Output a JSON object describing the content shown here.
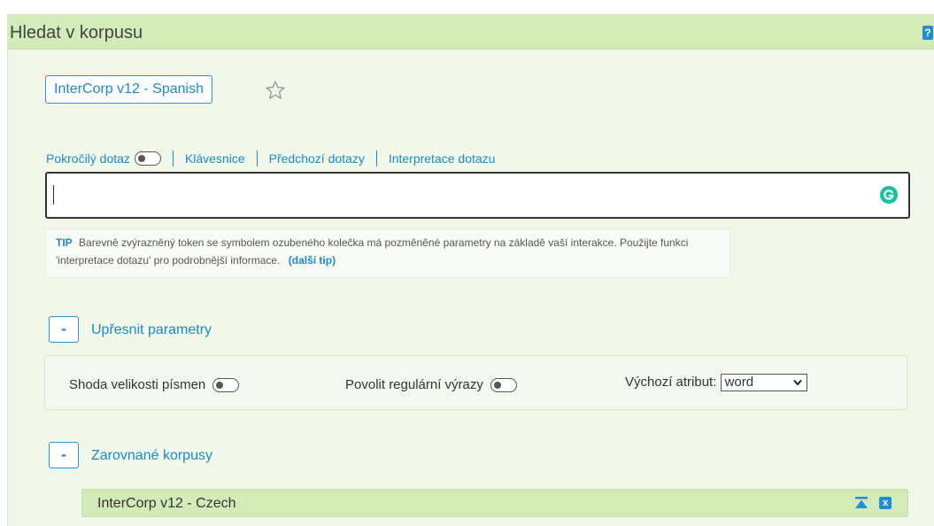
{
  "header": {
    "title": "Hledat v korpusu",
    "help_label": "?"
  },
  "corpus": {
    "name": "InterCorp v12 - Spanish"
  },
  "query_links": {
    "advanced": "Pokročilý dotaz",
    "keyboard": "Klávesnice",
    "history": "Předchozí dotazy",
    "interpretation": "Interpretace dotazu"
  },
  "query_input": {
    "value": ""
  },
  "tip": {
    "label": "TIP",
    "text": "Barevně zvýrazněný token se symbolem ozubeného kolečka má pozměněné parametry na základě vaší interakce. Použijte funkci 'interpretace dotazu' pro podrobnější informace.",
    "link": "(další tip)"
  },
  "refine": {
    "toggle_label": "-",
    "title": "Upřesnit parametry"
  },
  "params": {
    "case": "Shoda velikosti písmen",
    "regex": "Povolit regulární výrazy",
    "default_attr_label": "Výchozí atribut:",
    "default_attr_value": "word"
  },
  "aligned": {
    "toggle_label": "-",
    "title": "Zarovnané korpusy",
    "corpus_name": "InterCorp v12 - Czech",
    "close_label": "x"
  },
  "colors": {
    "accent": "#1a8ad0",
    "header_bg": "#d2ebb8",
    "panel_bg": "#f1f8ea",
    "grammarly": "#15c39a"
  },
  "icons": {
    "help": "help-icon",
    "star": "star-icon",
    "grammarly": "grammarly-icon",
    "move_top": "move-top-icon",
    "close": "close-icon",
    "chevron": "chevron-down-icon"
  }
}
